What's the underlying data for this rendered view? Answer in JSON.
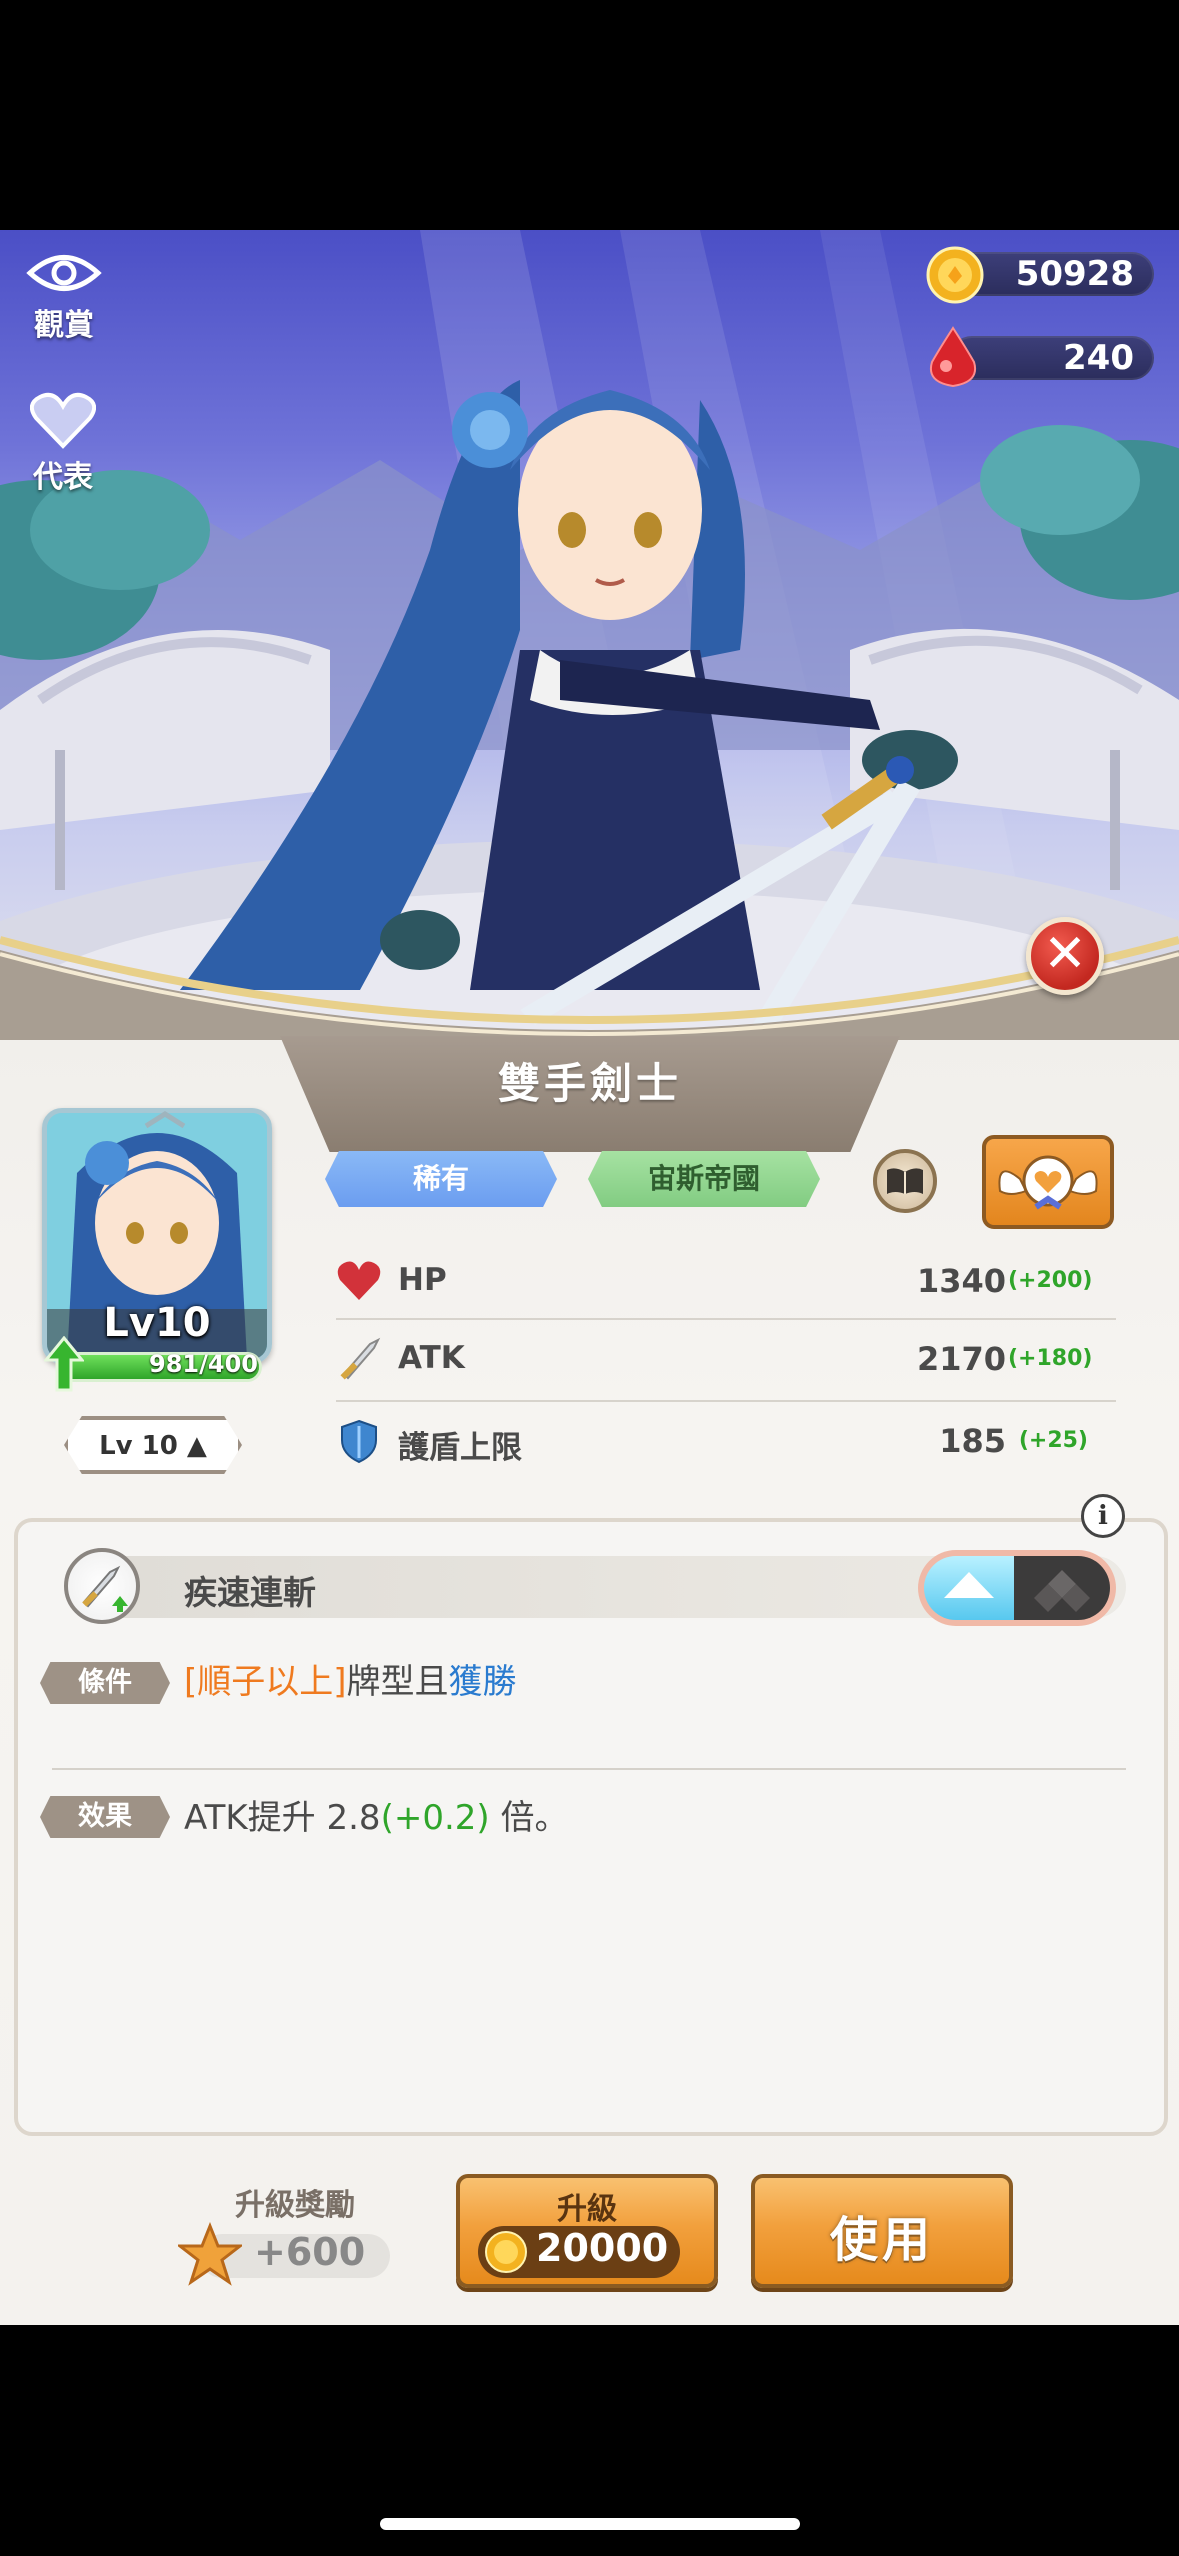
{
  "top": {
    "view_label": "觀賞",
    "represent_label": "代表",
    "coins": "50928",
    "gems": "240"
  },
  "character": {
    "class_name": "雙手劍士",
    "level_label": "Lv10",
    "exp_text": "981/400",
    "exp_fraction": 1.0,
    "level_badge": "Lv 10 ▲",
    "rarity": "稀有",
    "faction": "宙斯帝國"
  },
  "stats": [
    {
      "name": "HP",
      "value": "1340",
      "bonus": "(+200)"
    },
    {
      "name": "ATK",
      "value": "2170",
      "bonus": "(+180)"
    },
    {
      "name": "護盾上限",
      "value": "185",
      "bonus": "(+25)"
    }
  ],
  "skill": {
    "name": "疾速連斬",
    "condition_label": "條件",
    "condition_bracket": "[順子以上]",
    "condition_mid": "牌型且",
    "condition_win": "獲勝",
    "effect_label": "效果",
    "effect_pre": "ATK提升 2.8",
    "effect_bonus": "(+0.2)",
    "effect_post": " 倍。",
    "info_icon": "i"
  },
  "bottom": {
    "reward_title": "升級獎勵",
    "reward_value": "+600",
    "upgrade_label": "升級",
    "upgrade_cost": "20000",
    "use_label": "使用"
  },
  "colors": {
    "accent_orange": "#ef7a1f",
    "bonus_green": "#2fa52a",
    "win_blue": "#2a7bcf"
  }
}
